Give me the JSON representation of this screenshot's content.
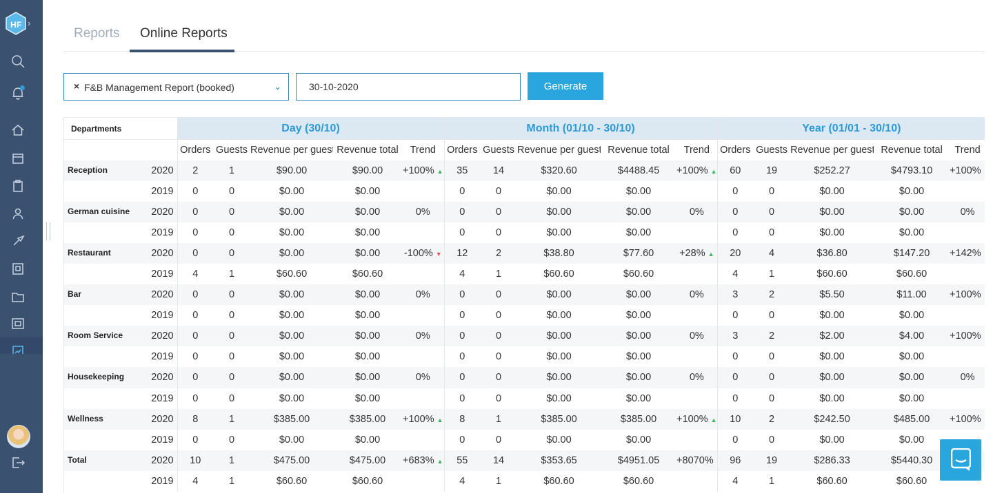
{
  "nav": {
    "tabs": [
      "Reports",
      "Online Reports"
    ],
    "active_tab": "Online Reports"
  },
  "controls": {
    "report_select": "F&B Management Report (booked)",
    "date_value": "30-10-2020",
    "generate_label": "Generate"
  },
  "table": {
    "dept_header": "Departments",
    "groups": [
      "Day (30/10)",
      "Month (01/10 - 30/10)",
      "Year (01/01 - 30/10)"
    ],
    "columns": [
      "Orders",
      "Guests",
      "Revenue per guest",
      "Revenue total",
      "Trend"
    ],
    "rows": [
      {
        "dept": "Reception",
        "year": "2020",
        "day": [
          "2",
          "1",
          "$90.00",
          "$90.00",
          "+100%"
        ],
        "month": [
          "35",
          "14",
          "$320.60",
          "$4488.45",
          "+100%"
        ],
        "ytd": [
          "60",
          "19",
          "$252.27",
          "$4793.10",
          "+100%"
        ]
      },
      {
        "dept": "",
        "year": "2019",
        "day": [
          "0",
          "0",
          "$0.00",
          "$0.00",
          ""
        ],
        "month": [
          "0",
          "0",
          "$0.00",
          "$0.00",
          ""
        ],
        "ytd": [
          "0",
          "0",
          "$0.00",
          "$0.00",
          ""
        ]
      },
      {
        "dept": "German cuisine",
        "year": "2020",
        "day": [
          "0",
          "0",
          "$0.00",
          "$0.00",
          "0%"
        ],
        "month": [
          "0",
          "0",
          "$0.00",
          "$0.00",
          "0%"
        ],
        "ytd": [
          "0",
          "0",
          "$0.00",
          "$0.00",
          "0%"
        ]
      },
      {
        "dept": "",
        "year": "2019",
        "day": [
          "0",
          "0",
          "$0.00",
          "$0.00",
          ""
        ],
        "month": [
          "0",
          "0",
          "$0.00",
          "$0.00",
          ""
        ],
        "ytd": [
          "0",
          "0",
          "$0.00",
          "$0.00",
          ""
        ]
      },
      {
        "dept": "Restaurant",
        "year": "2020",
        "day": [
          "0",
          "0",
          "$0.00",
          "$0.00",
          "-100%"
        ],
        "month": [
          "12",
          "2",
          "$38.80",
          "$77.60",
          "+28%"
        ],
        "ytd": [
          "20",
          "4",
          "$36.80",
          "$147.20",
          "+142%"
        ]
      },
      {
        "dept": "",
        "year": "2019",
        "day": [
          "4",
          "1",
          "$60.60",
          "$60.60",
          ""
        ],
        "month": [
          "4",
          "1",
          "$60.60",
          "$60.60",
          ""
        ],
        "ytd": [
          "4",
          "1",
          "$60.60",
          "$60.60",
          ""
        ]
      },
      {
        "dept": "Bar",
        "year": "2020",
        "day": [
          "0",
          "0",
          "$0.00",
          "$0.00",
          "0%"
        ],
        "month": [
          "0",
          "0",
          "$0.00",
          "$0.00",
          "0%"
        ],
        "ytd": [
          "3",
          "2",
          "$5.50",
          "$11.00",
          "+100%"
        ]
      },
      {
        "dept": "",
        "year": "2019",
        "day": [
          "0",
          "0",
          "$0.00",
          "$0.00",
          ""
        ],
        "month": [
          "0",
          "0",
          "$0.00",
          "$0.00",
          ""
        ],
        "ytd": [
          "0",
          "0",
          "$0.00",
          "$0.00",
          ""
        ]
      },
      {
        "dept": "Room Service",
        "year": "2020",
        "day": [
          "0",
          "0",
          "$0.00",
          "$0.00",
          "0%"
        ],
        "month": [
          "0",
          "0",
          "$0.00",
          "$0.00",
          "0%"
        ],
        "ytd": [
          "3",
          "2",
          "$2.00",
          "$4.00",
          "+100%"
        ]
      },
      {
        "dept": "",
        "year": "2019",
        "day": [
          "0",
          "0",
          "$0.00",
          "$0.00",
          ""
        ],
        "month": [
          "0",
          "0",
          "$0.00",
          "$0.00",
          ""
        ],
        "ytd": [
          "0",
          "0",
          "$0.00",
          "$0.00",
          ""
        ]
      },
      {
        "dept": "Housekeeping",
        "year": "2020",
        "day": [
          "0",
          "0",
          "$0.00",
          "$0.00",
          "0%"
        ],
        "month": [
          "0",
          "0",
          "$0.00",
          "$0.00",
          "0%"
        ],
        "ytd": [
          "0",
          "0",
          "$0.00",
          "$0.00",
          "0%"
        ]
      },
      {
        "dept": "",
        "year": "2019",
        "day": [
          "0",
          "0",
          "$0.00",
          "$0.00",
          ""
        ],
        "month": [
          "0",
          "0",
          "$0.00",
          "$0.00",
          ""
        ],
        "ytd": [
          "0",
          "0",
          "$0.00",
          "$0.00",
          ""
        ]
      },
      {
        "dept": "Wellness",
        "year": "2020",
        "day": [
          "8",
          "1",
          "$385.00",
          "$385.00",
          "+100%"
        ],
        "month": [
          "8",
          "1",
          "$385.00",
          "$385.00",
          "+100%"
        ],
        "ytd": [
          "10",
          "2",
          "$242.50",
          "$485.00",
          "+100%"
        ]
      },
      {
        "dept": "",
        "year": "2019",
        "day": [
          "0",
          "0",
          "$0.00",
          "$0.00",
          ""
        ],
        "month": [
          "0",
          "0",
          "$0.00",
          "$0.00",
          ""
        ],
        "ytd": [
          "0",
          "0",
          "$0.00",
          "$0.00",
          ""
        ]
      },
      {
        "dept": "Total",
        "year": "2020",
        "day": [
          "10",
          "1",
          "$475.00",
          "$475.00",
          "+683%"
        ],
        "month": [
          "55",
          "14",
          "$353.65",
          "$4951.05",
          "+8070%"
        ],
        "ytd": [
          "96",
          "19",
          "$286.33",
          "$5440.30",
          ""
        ]
      },
      {
        "dept": "",
        "year": "2019",
        "day": [
          "4",
          "1",
          "$60.60",
          "$60.60",
          ""
        ],
        "month": [
          "4",
          "1",
          "$60.60",
          "$60.60",
          ""
        ],
        "ytd": [
          "4",
          "1",
          "$60.60",
          "$60.60",
          ""
        ]
      }
    ]
  },
  "colors": {
    "sidebar": "#3b5170",
    "accent": "#2aa6de",
    "trend_up": "#3cb85c",
    "trend_down": "#e25353"
  }
}
